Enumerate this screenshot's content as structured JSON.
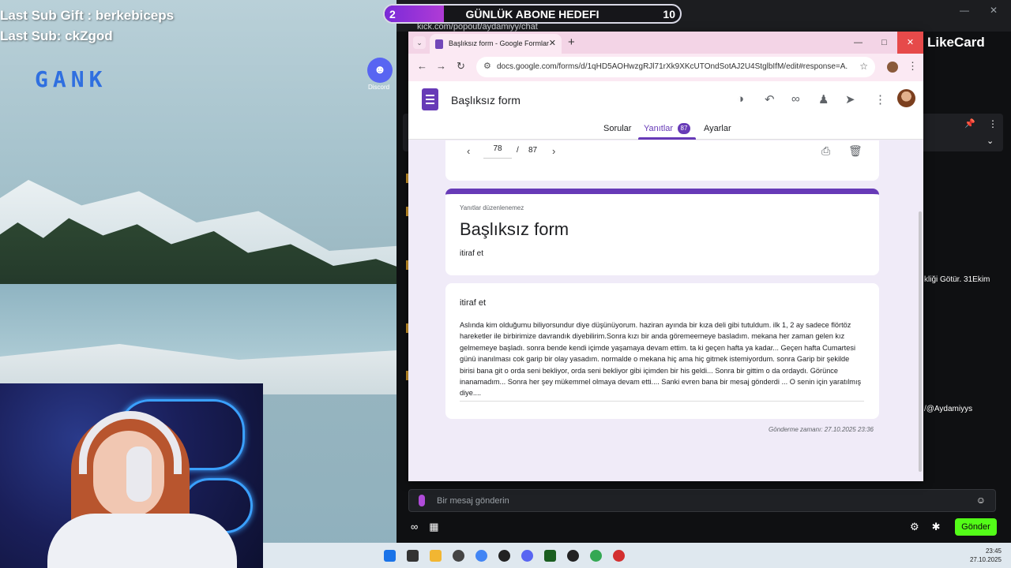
{
  "overlay": {
    "last_sub_gift": "Last Sub Gift : berkebiceps",
    "last_sub": "Last Sub: ckZgod",
    "logo_text": "GANK",
    "discord_label": "Discord",
    "discord_icon": "discord-icon"
  },
  "goal": {
    "current": "2",
    "title": "GÜNLÜK ABONE HEDEFI",
    "target": "10",
    "progress_fraction": 0.2
  },
  "chat_window": {
    "address": "kick.com/popout/aydamiyy/chat",
    "brand": "LikeCard",
    "fragment_1": "kliği Götür. 31Ekim",
    "fragment_2": "/@Aydamiyys",
    "input_placeholder": "Bir mesaj gönderin",
    "send_label": "Gönder",
    "accent": "#53fc18"
  },
  "browser": {
    "tab_title": "Başlıksız form - Google Formlar",
    "url": "docs.google.com/forms/d/1qHD5AOHwzgRJl71rXk9XKcUTOndSotAJ2U4StglbIfM/edit#response=A..."
  },
  "forms": {
    "doc_title": "Başlıksız form",
    "tabs": {
      "questions": "Sorular",
      "responses": "Yanıtlar",
      "settings": "Ayarlar"
    },
    "response_count": "87",
    "pager": {
      "current": "78",
      "separator": "/",
      "total": "87"
    },
    "title_card": {
      "note": "Yanıtlar düzenlenemez",
      "title": "Başlıksız form",
      "description": "itiraf et"
    },
    "answer_card": {
      "question": "itiraf et",
      "answer": "Aslında kim olduğumu biliyorsundur diye düşünüyorum. haziran ayında bir kıza deli gibi tutuldum. ilk 1, 2 ay sadece flörtöz hareketler ile birbirimize davrandık diyebilirim.Sonra kızı bir anda göremeemeye basladım. mekana her zaman gelen kız gelmemeye başladı. sonra bende kendi içimde yaşamaya devam ettim. ta ki geçen hafta ya kadar... Geçen hafta Cumartesi günü inanılması cok garip bir olay yasadım. normalde o mekana hiç ama hiç gitmek istemiyordum. sonra Garip bir şekilde birisi bana git o orda seni bekliyor, orda seni bekliyor gibi içimden bir his geldi... Sonra bir gittim o da ordaydı. Görünce inanamadım... Sonra her şey mükemmel olmaya devam etti.... Sanki evren bana bir mesaj gönderdi ... O senin için yaratılmış diye...."
    },
    "submitted": "Gönderme zamanı: 27.10.2025 23:36",
    "accent": "#673ab7"
  },
  "taskbar": {
    "time": "23:45",
    "date": "27.10.2025"
  }
}
